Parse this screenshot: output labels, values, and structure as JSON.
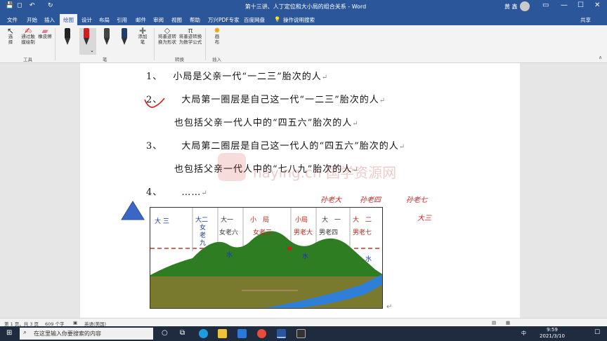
{
  "window": {
    "title": "第十三讲、人丁定位和大小局的组合关系 - Word",
    "user_name": "黄 鑫",
    "minimize": "—",
    "maximize": "☐",
    "close": "✕"
  },
  "quick_access": {
    "save": "💾",
    "undo": "↶",
    "redo": "↻"
  },
  "tabs": [
    "文件",
    "开始",
    "插入",
    "绘图",
    "设计",
    "布局",
    "引用",
    "邮件",
    "审阅",
    "视图",
    "帮助",
    "万兴PDF专家",
    "百度网盘"
  ],
  "active_tab": "绘图",
  "tell_me": "操作说明搜索",
  "share": "共享",
  "ribbon": {
    "select_label": "选择",
    "stroke_erase_label": "通过触摸绘制",
    "eraser_label": "橡皮擦",
    "tools_group": "工具",
    "pens_group": "笔",
    "add_pen_label": "添加笔",
    "ink_to_shape_label": "将墨迹转换为形状",
    "ink_to_math_label": "将墨迹转换为数学公式",
    "convert_group": "转换",
    "canvas_label": "画布",
    "insert_group": "插入"
  },
  "pen_colors": [
    "#222222",
    "#d21f1f",
    "#444444",
    "#1f3d6e"
  ],
  "document": {
    "lines": [
      {
        "num": "1、",
        "text": "小局是父亲一代“一二三”胎次的人"
      },
      {
        "num": "2、",
        "text": "大局第一圈层是自己这一代“一二三”胎次的人"
      },
      {
        "num": "",
        "text": "也包括父亲一代人中的“四五六”胎次的人"
      },
      {
        "num": "3、",
        "text": "大局第二圈层是自己这一代人的“四五六”胎次的人"
      },
      {
        "num": "",
        "text": "也包括父亲一代人中的“七八九”胎次的人"
      },
      {
        "num": "4、",
        "text": "……"
      }
    ],
    "para_mark": "↵",
    "watermark": "naying.cn 国学资源网",
    "handwriting": [
      "孙老大",
      "孙老四",
      "孙老七",
      "大三"
    ]
  },
  "picture": {
    "labels": [
      {
        "top": "大 三",
        "sub": ""
      },
      {
        "top": "大二",
        "sub": "女老九"
      },
      {
        "top": "大一",
        "sub": "女老六"
      },
      {
        "top": "小　局",
        "sub": "女老三"
      },
      {
        "top": "小局",
        "sub": "男老大"
      },
      {
        "top": "大　一",
        "sub": "男老四"
      },
      {
        "top": "大　二",
        "sub": "男老七"
      }
    ],
    "water_labels": [
      "水",
      "水",
      "水"
    ],
    "title_hidden": ""
  },
  "status": {
    "page": "第 1 页，共 3 页",
    "words": "609 个字",
    "lang": "英语(美国)"
  },
  "taskbar": {
    "search_placeholder": "在这里输入你要搜索的内容",
    "time": "9:59",
    "date": "2021/3/10",
    "ime": "中"
  }
}
